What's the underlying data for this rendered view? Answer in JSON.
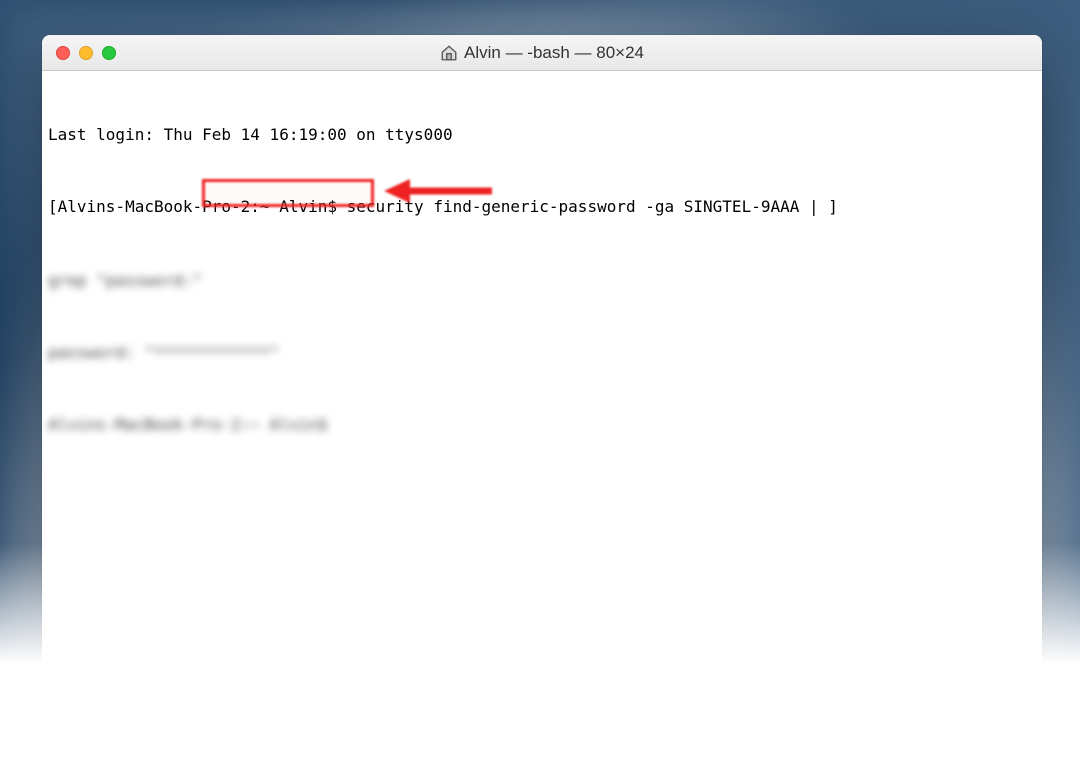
{
  "titlebar": {
    "title": "Alvin — -bash — 80×24",
    "home_icon": "home-icon"
  },
  "traffic": {
    "close": "close",
    "minimize": "minimize",
    "zoom": "zoom"
  },
  "terminal": {
    "line1": "Last login: Thu Feb 14 16:19:00 on ttys000",
    "line2": "[Alvins-MacBook-Pro-2:~ Alvin$ security find-generic-password -ga SINGTEL-9AAA | ]",
    "blurred1": "grep \"password:\"",
    "blurred2": "password: \"************\"",
    "blurred3": "Alvins-MacBook-Pro-2:~ Alvin$ "
  },
  "annotation": {
    "highlight_color": "#e22222",
    "arrow_color": "#e22222"
  }
}
